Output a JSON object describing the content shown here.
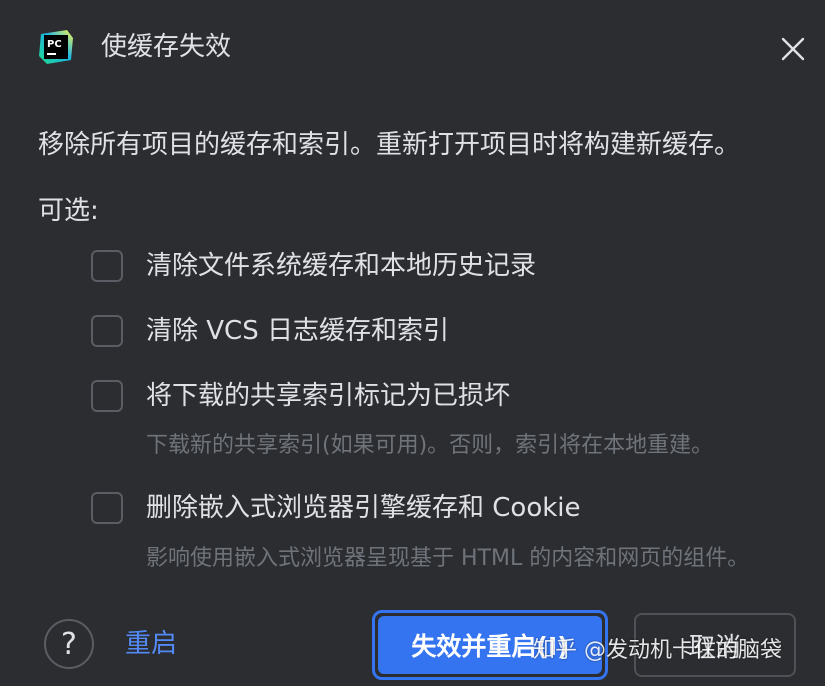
{
  "dialog": {
    "title": "使缓存失效",
    "description": "移除所有项目的缓存和索引。重新打开项目时将构建新缓存。",
    "optional_label": "可选:"
  },
  "options": [
    {
      "label": "清除文件系统缓存和本地历史记录",
      "checked": false,
      "hint": ""
    },
    {
      "label": "清除 VCS 日志缓存和索引",
      "checked": false,
      "hint": ""
    },
    {
      "label": "将下载的共享索引标记为已损坏",
      "checked": false,
      "hint": "下载新的共享索引(如果可用)。否则，索引将在本地重建。"
    },
    {
      "label": "删除嵌入式浏览器引擎缓存和 Cookie",
      "checked": false,
      "hint": "影响使用嵌入式浏览器呈现基于 HTML 的内容和网页的组件。"
    }
  ],
  "footer": {
    "help_label": "?",
    "restart_label": "重启",
    "invalidate_restart_label": "失效并重启(I)",
    "cancel_label": "取消"
  },
  "app_icon": {
    "name": "pycharm-icon",
    "text": "PC"
  },
  "watermark": "知乎 @发动机卡住的脑袋",
  "colors": {
    "background": "#2b2d30",
    "text": "#dfe1e5",
    "hint": "#6f737a",
    "accent": "#3574f0",
    "link": "#548af7",
    "border": "#5a5d63"
  }
}
